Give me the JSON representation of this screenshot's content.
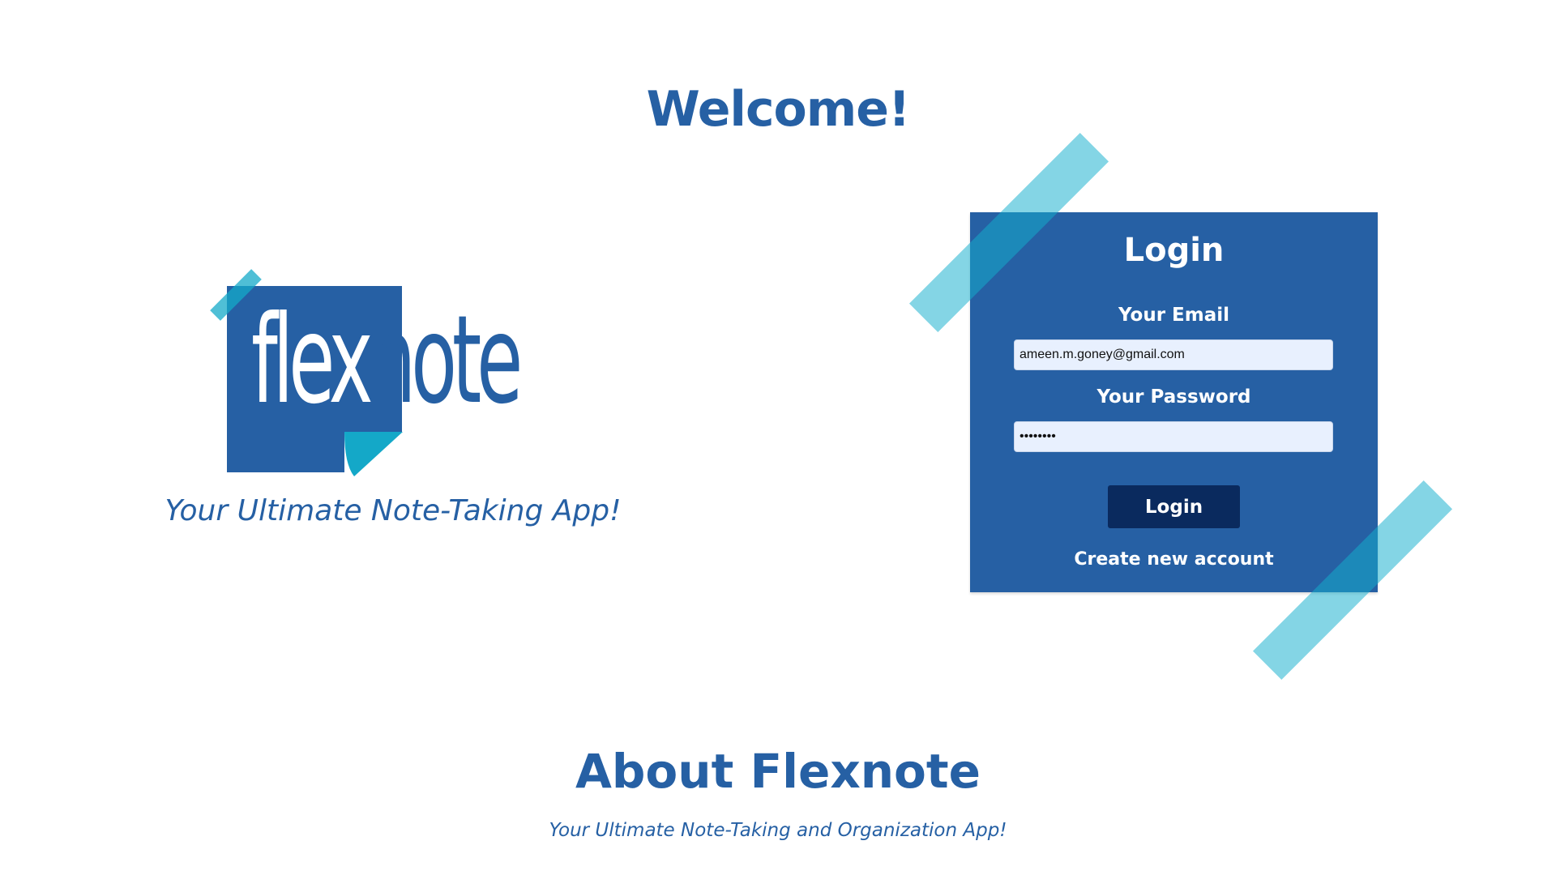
{
  "header": {
    "welcome": "Welcome!"
  },
  "brand": {
    "logo_part1": "flex",
    "logo_part2": "note",
    "tagline": "Your Ultimate Note-Taking App!"
  },
  "login": {
    "title": "Login",
    "email_label": "Your Email",
    "email_value": "ameen.m.goney@gmail.com",
    "password_label": "Your Password",
    "password_value": "password",
    "button_label": "Login",
    "create_account_label": "Create new account"
  },
  "about": {
    "title": "About Flexnote",
    "subtitle": "Your Ultimate Note-Taking and Organization App!"
  },
  "colors": {
    "brand_blue": "#2660a4",
    "button_navy": "#0a2a5e",
    "tape_cyan": "#14afcd",
    "input_bg": "#e8f0fe"
  }
}
